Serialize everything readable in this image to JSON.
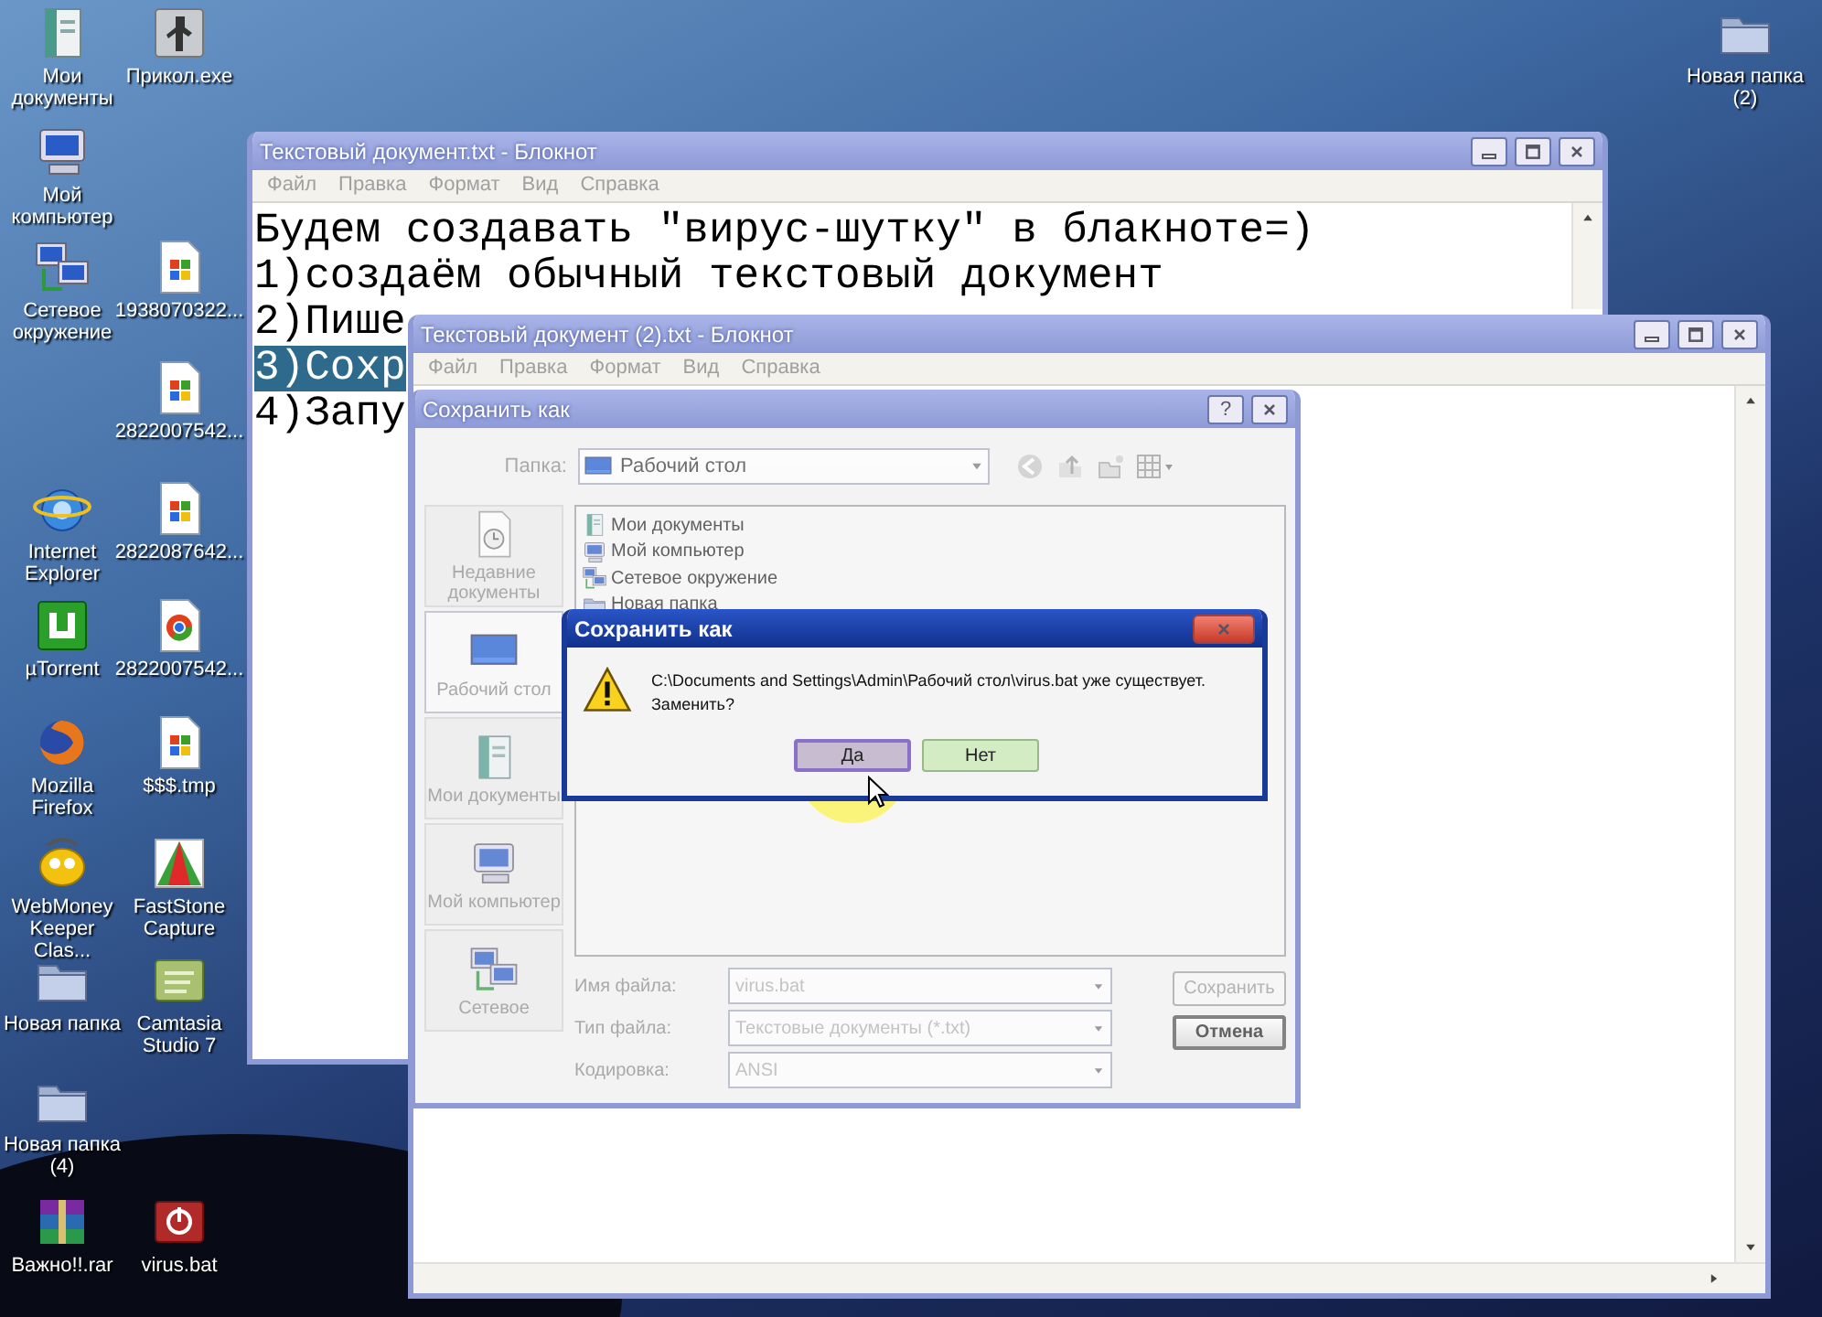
{
  "desktop": {
    "icons": [
      {
        "label": "Мои документы",
        "kind": "documents"
      },
      {
        "label": "Мой компьютер",
        "kind": "computer"
      },
      {
        "label": "Сетевое окружение",
        "kind": "network"
      },
      {
        "label": "Internet Explorer",
        "kind": "browser"
      },
      {
        "label": "µTorrent",
        "kind": "torrent"
      },
      {
        "label": "Mozilla Firefox",
        "kind": "firefox"
      },
      {
        "label": "WebMoney Keeper Clas...",
        "kind": "webmoney"
      },
      {
        "label": "Новая папка",
        "kind": "folder"
      },
      {
        "label": "Новая папка (4)",
        "kind": "folder"
      },
      {
        "label": "Важно!!.rar",
        "kind": "archive"
      },
      {
        "label": "Прикол.exe",
        "kind": "program"
      },
      {
        "label": "1938070322...",
        "kind": "image"
      },
      {
        "label": "2822007542...",
        "kind": "image"
      },
      {
        "label": "2822087642...",
        "kind": "image"
      },
      {
        "label": "2822007542...",
        "kind": "chrome_image"
      },
      {
        "label": "$$$.tmp",
        "kind": "image"
      },
      {
        "label": "FastStone Capture",
        "kind": "faststone"
      },
      {
        "label": "Camtasia Studio 7",
        "kind": "camtasia"
      },
      {
        "label": "virus.bat",
        "kind": "batch"
      },
      {
        "label": "Новая папка (2)",
        "kind": "folder"
      }
    ]
  },
  "notepad_back": {
    "title": "Текстовый документ.txt - Блокнот",
    "active": false,
    "menu": [
      "Файл",
      "Правка",
      "Формат",
      "Вид",
      "Справка"
    ],
    "lines": [
      {
        "text": "Будем создавать \"вирус-шутку\" в блакноте=)",
        "selected": false
      },
      {
        "text": "1)создаём обычный текстовый документ",
        "selected": false
      },
      {
        "text": "2)Пише",
        "selected": false
      },
      {
        "text": "3)Сохр",
        "selected": true
      },
      {
        "text": "4)Запу",
        "selected": false
      }
    ]
  },
  "notepad_front": {
    "title": "Текстовый документ (2).txt - Блокнот",
    "active": false,
    "menu": [
      "Файл",
      "Правка",
      "Формат",
      "Вид",
      "Справка"
    ]
  },
  "save_dialog": {
    "title": "Сохранить как",
    "disabled": true,
    "help_button": "?",
    "folder_label": "Папка:",
    "folder": "Рабочий стол",
    "places": [
      {
        "label": "Недавние документы",
        "kind": "recent",
        "selected": false
      },
      {
        "label": "Рабочий стол",
        "kind": "desktop",
        "selected": true
      },
      {
        "label": "Мои документы",
        "kind": "documents",
        "selected": false
      },
      {
        "label": "Мой компьютер",
        "kind": "computer",
        "selected": false
      },
      {
        "label": "Сетевое",
        "kind": "network",
        "selected": false
      }
    ],
    "files": [
      {
        "name": "Мои документы",
        "kind": "documents"
      },
      {
        "name": "Мой компьютер",
        "kind": "computer"
      },
      {
        "name": "Сетевое окружение",
        "kind": "network"
      },
      {
        "name": "Новая папка",
        "kind": "folder"
      }
    ],
    "fields": [
      {
        "label": "Имя файла:",
        "value": "virus.bat"
      },
      {
        "label": "Тип файла:",
        "value": "Текстовые документы (*.txt)"
      },
      {
        "label": "Кодировка:",
        "value": "ANSI"
      }
    ],
    "buttons": [
      {
        "label": "Сохранить",
        "default": false
      },
      {
        "label": "Отмена",
        "default": true
      }
    ]
  },
  "confirm_dialog": {
    "title": "Сохранить как",
    "active": true,
    "message": "C:\\Documents and Settings\\Admin\\Рабочий стол\\virus.bat уже существует.\nЗаменить?",
    "buttons": [
      {
        "label": "Да",
        "focused": true
      },
      {
        "label": "Нет",
        "focused": false
      }
    ]
  }
}
